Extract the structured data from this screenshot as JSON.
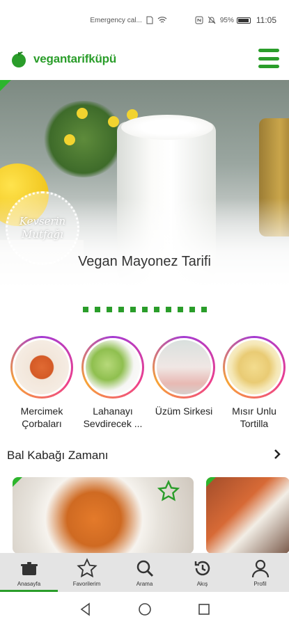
{
  "status_bar": {
    "emergency": "Emergency cal...",
    "battery": "95%",
    "time": "11:05"
  },
  "header": {
    "brand": "vegantarifküpü",
    "logo_icon": "apple-logo-icon",
    "menu_icon": "hamburger-menu-icon",
    "brand_color": "#2a9d2a"
  },
  "hero": {
    "title": "Vegan Mayonez Tarifi",
    "watermark_line1": "Kevserin",
    "watermark_line2": "Mutfağı"
  },
  "carousel": {
    "dot_count": 11
  },
  "categories": [
    {
      "label": "Mercimek Çorbaları"
    },
    {
      "label": "Lahanayı Sevdirecek ..."
    },
    {
      "label": "Üzüm Sirkesi"
    },
    {
      "label": "Mısır Unlu Tortilla"
    }
  ],
  "section": {
    "title": "Bal Kabağı Zamanı",
    "chevron_icon": "chevron-right-icon"
  },
  "bottom_nav": [
    {
      "label": "Anasayfa",
      "icon": "pot-icon",
      "active": true
    },
    {
      "label": "Favorilerim",
      "icon": "star-icon",
      "active": false
    },
    {
      "label": "Arama",
      "icon": "search-icon",
      "active": false
    },
    {
      "label": "Akış",
      "icon": "history-icon",
      "active": false
    },
    {
      "label": "Profil",
      "icon": "user-icon",
      "active": false
    }
  ]
}
